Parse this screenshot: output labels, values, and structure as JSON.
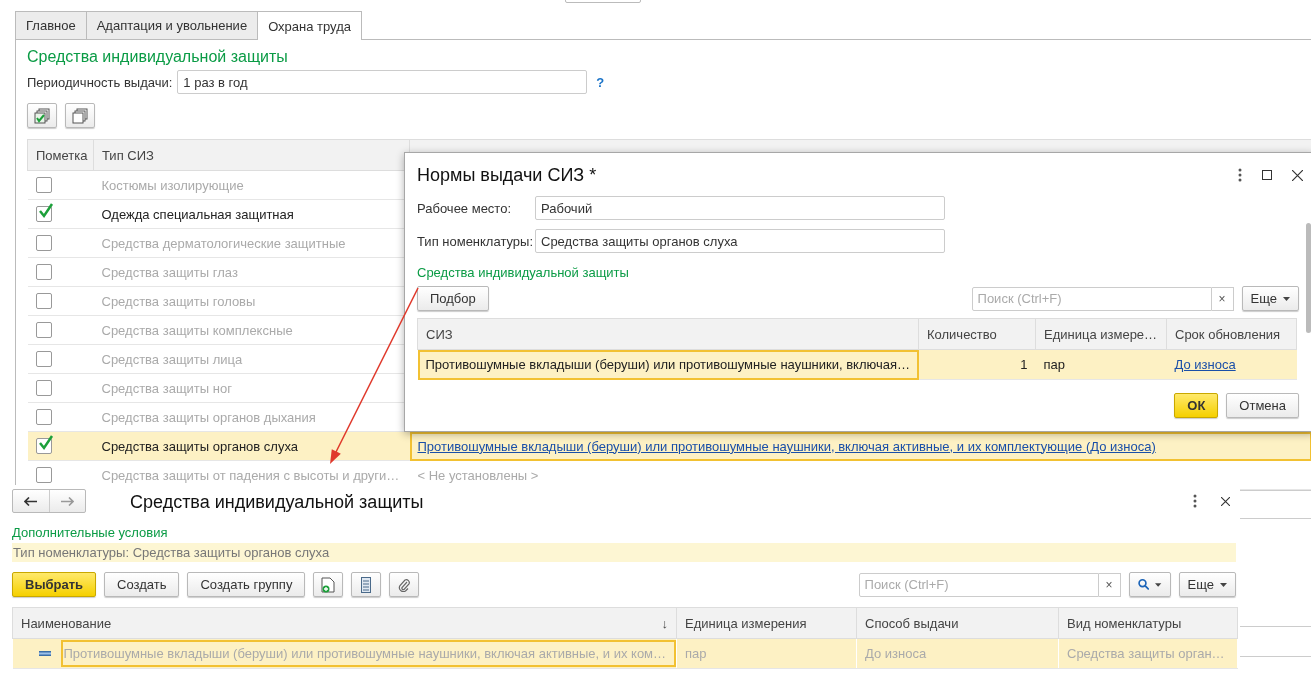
{
  "tabs": [
    {
      "label": "Главное",
      "selected": false
    },
    {
      "label": "Адаптация и увольнение",
      "selected": false
    },
    {
      "label": "Охрана труда",
      "selected": true
    }
  ],
  "section_title": "Средства индивидуальной защиты",
  "periodicity": {
    "label": "Периодичность выдачи:",
    "value": "1 раз в год",
    "help": "?"
  },
  "table": {
    "columns": [
      "Пометка",
      "Тип СИЗ"
    ],
    "rows": [
      {
        "checked": false,
        "selected": false,
        "type": "Костюмы изолирующие"
      },
      {
        "checked": true,
        "selected": false,
        "type": "Одежда специальная защитная"
      },
      {
        "checked": false,
        "selected": false,
        "type": "Средства дерматологические защитные"
      },
      {
        "checked": false,
        "selected": false,
        "type": "Средства защиты глаз"
      },
      {
        "checked": false,
        "selected": false,
        "type": "Средства защиты головы"
      },
      {
        "checked": false,
        "selected": false,
        "type": "Средства защиты комплексные"
      },
      {
        "checked": false,
        "selected": false,
        "type": "Средства защиты лица"
      },
      {
        "checked": false,
        "selected": false,
        "type": "Средства защиты ног"
      },
      {
        "checked": false,
        "selected": false,
        "type": "Средства защиты органов дыхания"
      },
      {
        "checked": true,
        "selected": true,
        "type": "Средства защиты органов слуха",
        "norm": "Противошумные вкладыши (беруши) или противошумные наушники, включая активные, и их комплектующие (До износа)"
      },
      {
        "checked": false,
        "selected": false,
        "type": "Средства защиты от падения с высоты и други…",
        "norm": "< Не установлены >"
      }
    ]
  },
  "dialog": {
    "title": "Нормы выдачи СИЗ *",
    "fields": [
      {
        "label": "Рабочее место:",
        "value": "Рабочий"
      },
      {
        "label": "Тип номенклатуры:",
        "value": "Средства защиты органов слуха"
      }
    ],
    "section": "Средства индивидуальной защиты",
    "pick_button": "Подбор",
    "search": {
      "placeholder": "Поиск (Ctrl+F)",
      "clear": "×"
    },
    "more_button": "Еще",
    "columns": [
      "СИЗ",
      "Количество",
      "Единица измере…",
      "Срок обновления"
    ],
    "rows": [
      {
        "selected": true,
        "item": "Противошумные вкладыши (беруши) или противошумные наушники, включая…",
        "qty": "1",
        "unit": "пар",
        "period": "До износа"
      }
    ],
    "ok": "ОК",
    "cancel": "Отмена"
  },
  "picker": {
    "title": "Средства индивидуальной защиты",
    "conditions": "Дополнительные условия",
    "filter": "Тип номенклатуры: Средства защиты органов слуха",
    "select_button": "Выбрать",
    "create_button": "Создать",
    "create_group_button": "Создать группу",
    "search": {
      "placeholder": "Поиск (Ctrl+F)",
      "clear": "×"
    },
    "more_button": "Еще",
    "columns": [
      {
        "label": "Наименование",
        "sort": "↓"
      },
      {
        "label": "Единица измерения"
      },
      {
        "label": "Способ выдачи"
      },
      {
        "label": "Вид номенклатуры"
      }
    ],
    "rows": [
      {
        "selected": true,
        "name": "Противошумные вкладыши (беруши) или противошумные наушники, включая активные, и их ком…",
        "unit": "пар",
        "method": "До износа",
        "kind_text": "Средства защиты орган…"
      }
    ]
  }
}
